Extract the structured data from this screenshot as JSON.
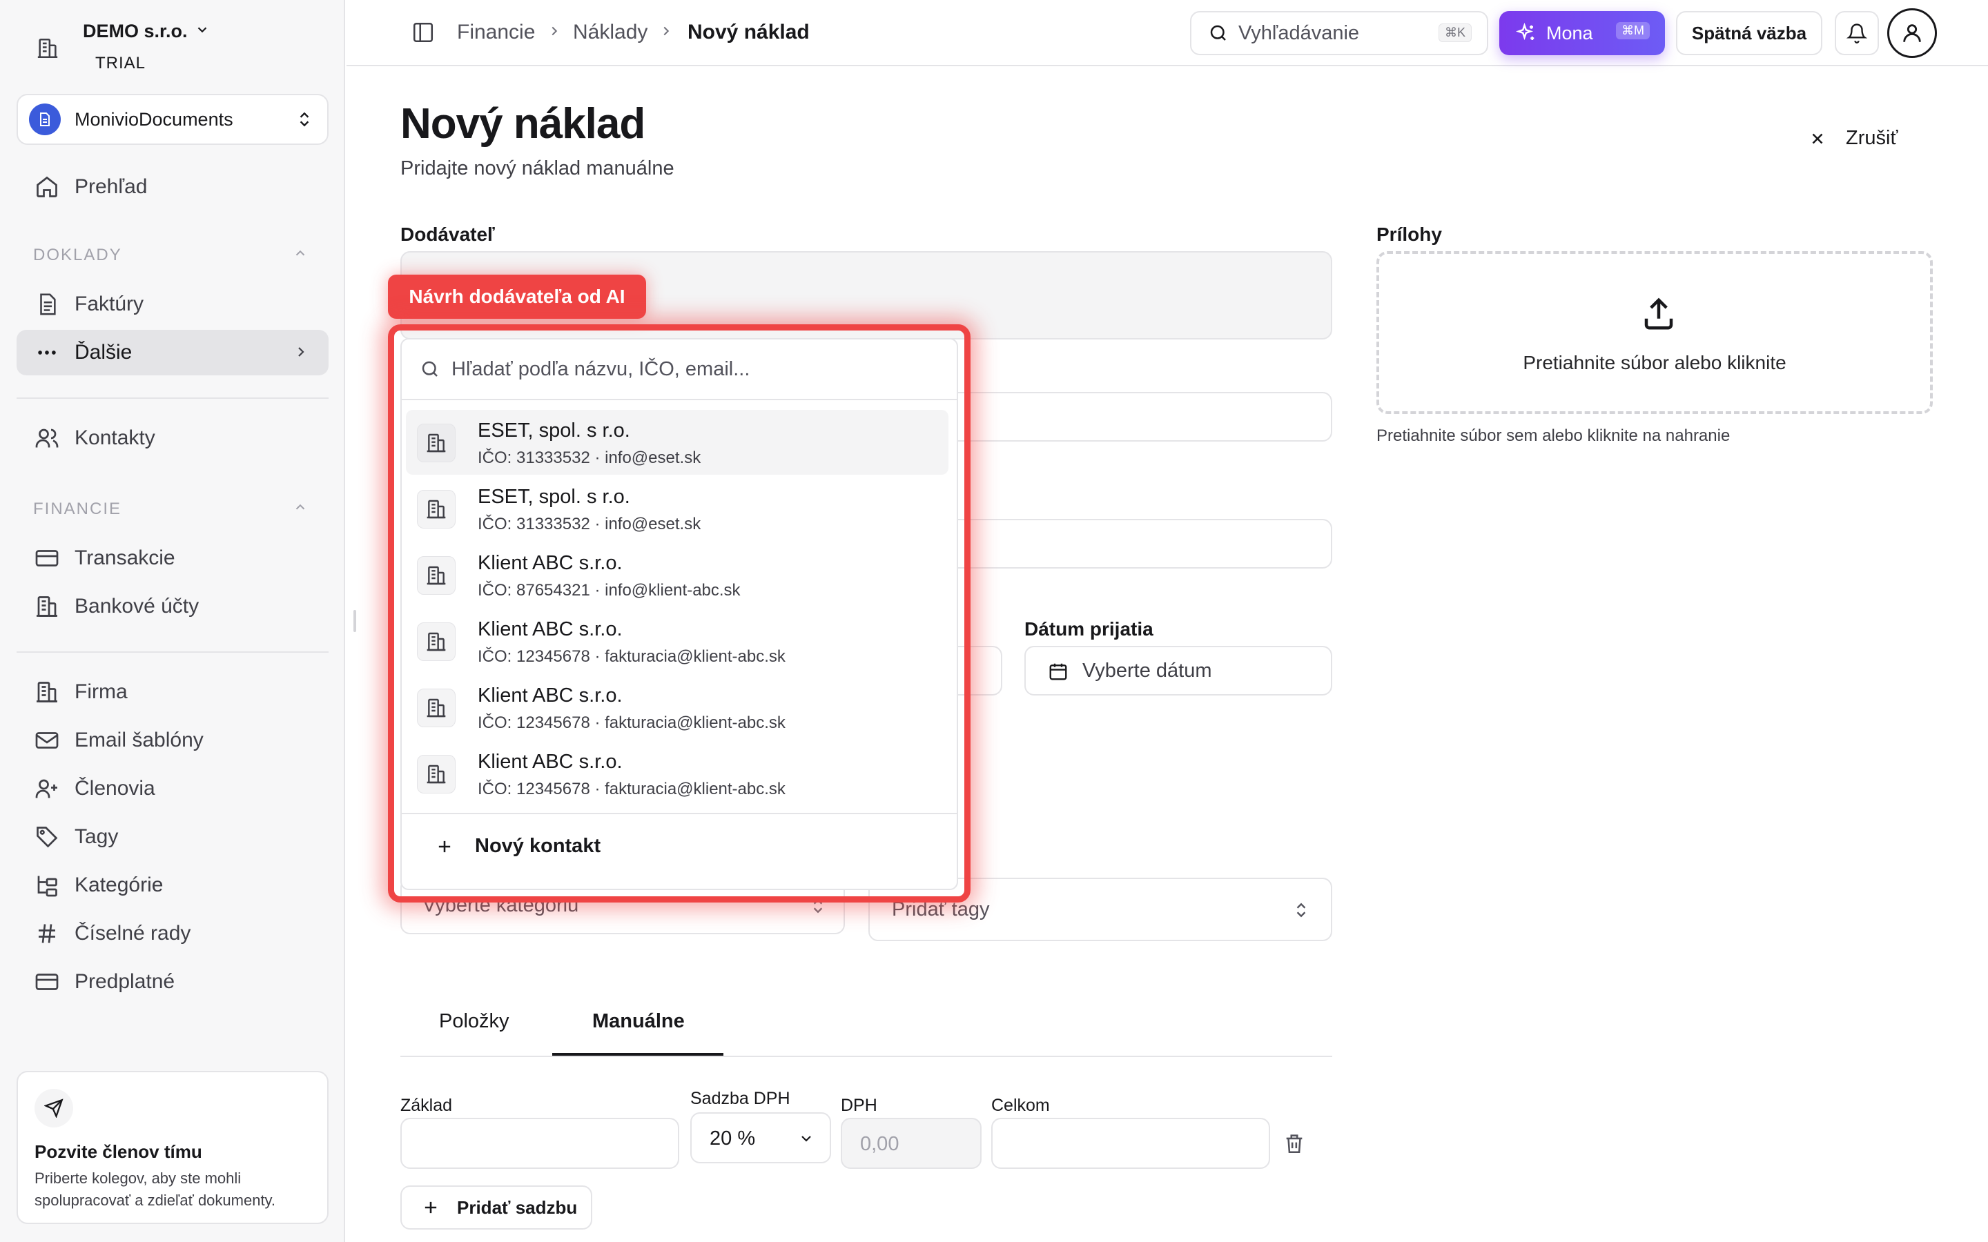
{
  "org": {
    "name": "DEMO s.r.o.",
    "plan": "TRIAL"
  },
  "app_select": {
    "name": "MonivioDocuments"
  },
  "sidebar": {
    "overview": "Prehľad",
    "section_docs": "DOKLADY",
    "invoices": "Faktúry",
    "more": "Ďalšie",
    "contacts": "Kontakty",
    "section_finance": "FINANCIE",
    "transactions": "Transakcie",
    "bank_accounts": "Bankové účty",
    "company": "Firma",
    "email_templates": "Email šablóny",
    "members": "Členovia",
    "tags": "Tagy",
    "categories": "Kategórie",
    "number_series": "Číselné rady",
    "subscription": "Predplatné"
  },
  "invite": {
    "title": "Pozvite členov tímu",
    "text": "Priberte kolegov, aby ste mohli spolupracovať a zdieľať dokumenty."
  },
  "topbar": {
    "crumb1": "Financie",
    "crumb2": "Náklady",
    "crumb3": "Nový náklad",
    "search_label": "Vyhľadávanie",
    "search_kbd": "⌘K",
    "mona_label": "Mona",
    "mona_kbd": "⌘M",
    "feedback": "Spätná väzba"
  },
  "page": {
    "title": "Nový náklad",
    "subtitle": "Pridajte nový náklad manuálne",
    "cancel": "Zrušiť"
  },
  "form": {
    "supplier_label": "Dodávateľ",
    "received_date_label": "Dátum prijatia",
    "received_date_placeholder": "Vyberte dátum",
    "category_placeholder": "Vyberte kategóriu",
    "tags_placeholder": "Pridať tagy"
  },
  "attachments": {
    "label": "Prílohy",
    "drop_text": "Pretiahnite súbor alebo kliknite",
    "hint": "Pretiahnite súbor sem alebo kliknite na nahranie"
  },
  "tabs": {
    "items": "Položky",
    "manual": "Manuálne"
  },
  "vat": {
    "base_label": "Základ",
    "rate_label": "Sadzba DPH",
    "rate_value": "20 %",
    "vat_label": "DPH",
    "vat_value": "0,00",
    "total_label": "Celkom",
    "add_rate": "Pridať sadzbu"
  },
  "ai_badge": "Návrh dodávateľa od AI",
  "supplier_dropdown": {
    "search_placeholder": "Hľadať podľa názvu, IČO, email...",
    "options": [
      {
        "name": "ESET, spol. s r.o.",
        "sub": "IČO: 31333532 · info@eset.sk"
      },
      {
        "name": "ESET, spol. s r.o.",
        "sub": "IČO: 31333532 · info@eset.sk"
      },
      {
        "name": "Klient ABC s.r.o.",
        "sub": "IČO: 87654321 · info@klient-abc.sk"
      },
      {
        "name": "Klient ABC s.r.o.",
        "sub": "IČO: 12345678 · fakturacia@klient-abc.sk"
      },
      {
        "name": "Klient ABC s.r.o.",
        "sub": "IČO: 12345678 · fakturacia@klient-abc.sk"
      },
      {
        "name": "Klient ABC s.r.o.",
        "sub": "IČO: 12345678 · fakturacia@klient-abc.sk"
      }
    ],
    "new_contact": "Nový kontakt"
  }
}
